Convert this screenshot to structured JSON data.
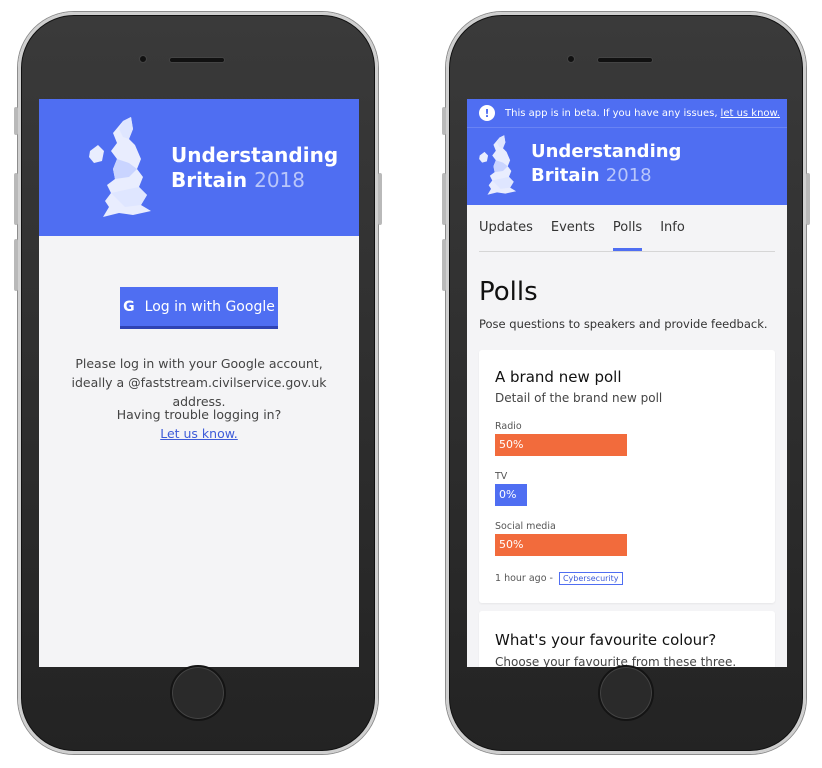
{
  "colors": {
    "brand_blue": "#4f6ef2",
    "bar_orange": "#f26b3c",
    "bar_blue": "#4f6ef2"
  },
  "left_screen": {
    "app_title_line1": "Understanding",
    "app_title_word2": "Britain",
    "app_title_year": "2018",
    "login_button_icon": "G",
    "login_button_label": "Log in with Google",
    "login_instructions": "Please log in with your Google account, ideally a @faststream.civilservice.gov.uk address.",
    "trouble_text": "Having trouble logging in?",
    "trouble_link": "Let us know."
  },
  "right_screen": {
    "beta_icon": "!",
    "beta_text": "This app is in beta. If you have any issues,",
    "beta_link": "let us know.",
    "app_title_line1": "Understanding",
    "app_title_word2": "Britain",
    "app_title_year": "2018",
    "tabs": [
      {
        "label": "Updates",
        "active": false
      },
      {
        "label": "Events",
        "active": false
      },
      {
        "label": "Polls",
        "active": true
      },
      {
        "label": "Info",
        "active": false
      }
    ],
    "page_title": "Polls",
    "page_subtitle": "Pose questions to speakers and provide feedback.",
    "polls": [
      {
        "title": "A brand new poll",
        "detail": "Detail of the brand new poll",
        "options": [
          {
            "label": "Radio",
            "percent_text": "50%",
            "fraction": 0.5,
            "color": "#f26b3c"
          },
          {
            "label": "TV",
            "percent_text": "0%",
            "fraction": 0.0,
            "color": "#4f6ef2"
          },
          {
            "label": "Social media",
            "percent_text": "50%",
            "fraction": 0.5,
            "color": "#f26b3c"
          }
        ],
        "time": "1 hour ago -",
        "tag": "Cybersecurity"
      },
      {
        "title": "What's your favourite colour?",
        "detail": "Choose your favourite from these three."
      }
    ]
  }
}
